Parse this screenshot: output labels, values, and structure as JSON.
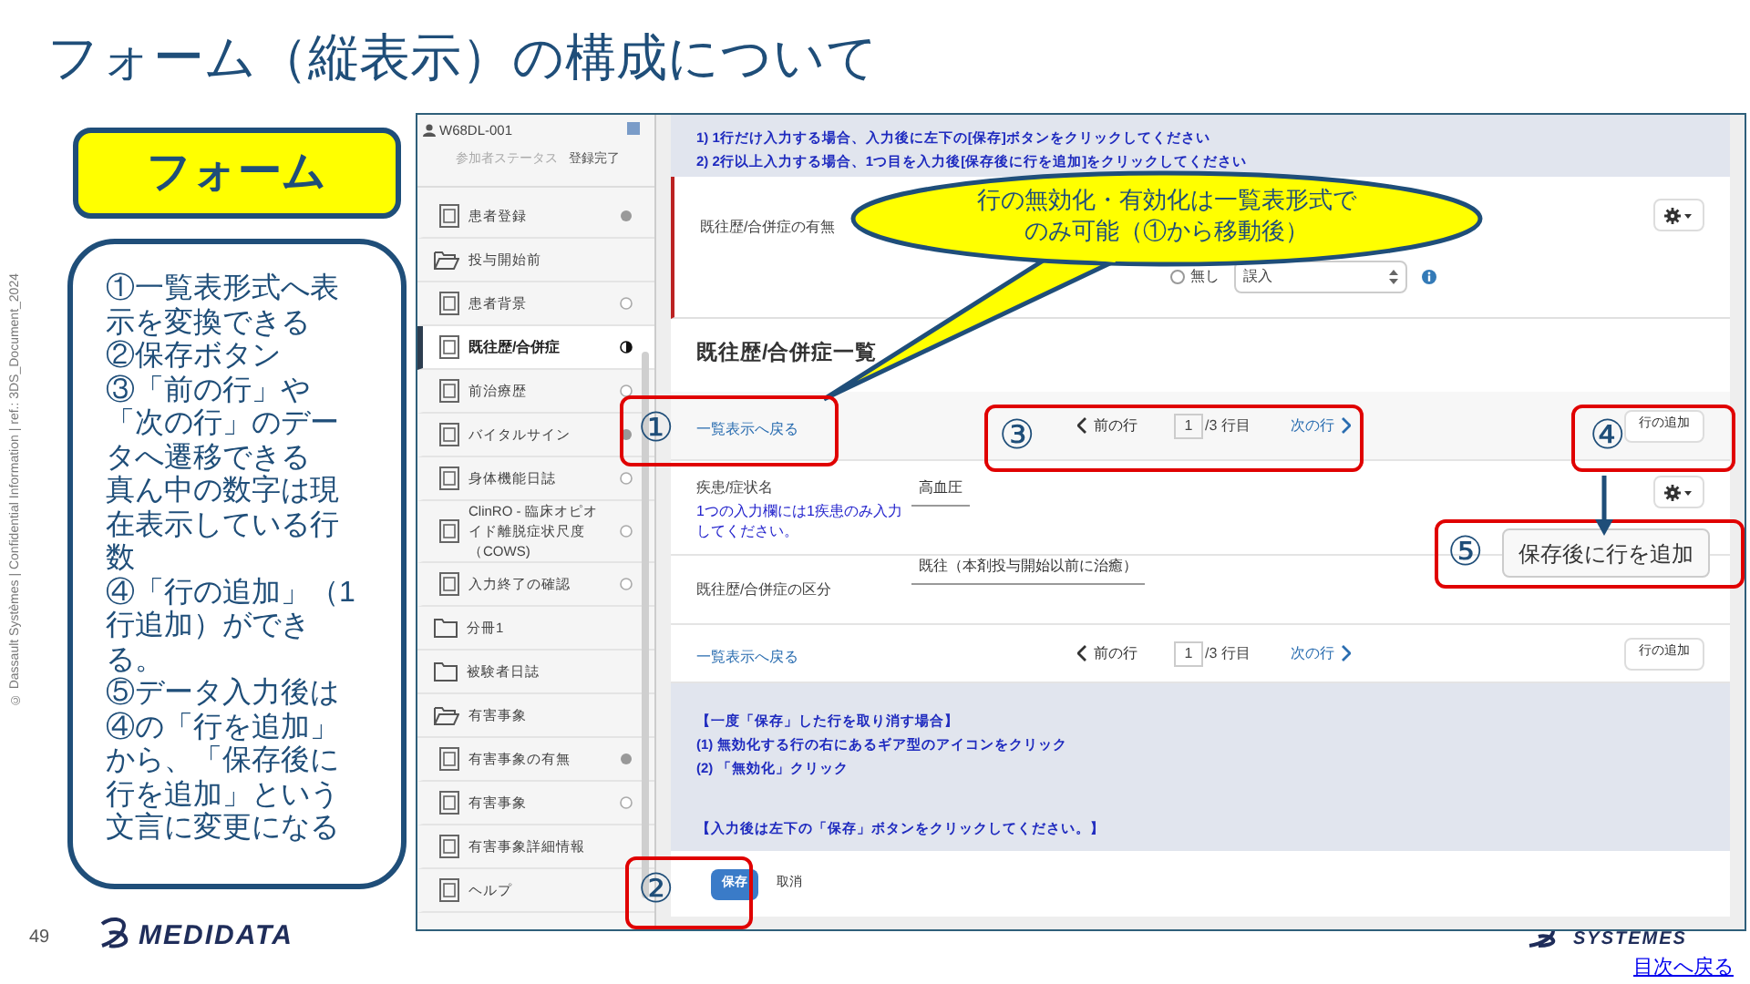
{
  "title": "フォーム（縦表示）の構成について",
  "form_label": "フォーム",
  "explanation": [
    "①一覧表形式へ表示を変換できる",
    "②保存ボタン",
    "③「前の行」や「次の行」のデータへ遷移できる",
    "真ん中の数字は現在表示している行数",
    "④「行の追加」（1行追加）ができる。",
    "⑤データ入力後は④の「行を追加」から、「保存後に行を追加」という文言に変更になる"
  ],
  "copyright": "© Dassault Systèmes | Confidential Information | ref.: 3DS_Document_2024",
  "page_number": "49",
  "footer_logo": "MEDIDATA",
  "corner_logo": "SYSTEMES",
  "toc_link": "目次へ戻る",
  "app": {
    "sidebar": {
      "subject": "W68DL-001",
      "status_label": "参加者ステータス",
      "status_value": "登録完了",
      "items": [
        {
          "kind": "page",
          "label": "患者登録",
          "complete": true,
          "partial": false,
          "selected": false
        },
        {
          "kind": "folder",
          "label": "投与開始前",
          "expanded": true
        },
        {
          "kind": "page",
          "label": "患者背景",
          "complete": false,
          "partial": false,
          "selected": false
        },
        {
          "kind": "page",
          "label": "既往歴/合併症",
          "complete": false,
          "partial": true,
          "selected": true
        },
        {
          "kind": "page",
          "label": "前治療歴",
          "complete": false,
          "partial": false,
          "selected": false
        },
        {
          "kind": "page",
          "label": "バイタルサイン",
          "complete": true,
          "partial": false,
          "selected": false
        },
        {
          "kind": "page",
          "label": "身体機能日誌",
          "complete": false,
          "partial": false,
          "selected": false
        },
        {
          "kind": "page",
          "label": "ClinRO - 臨床オピオイド離脱症状尺度（COWS)",
          "complete": false,
          "partial": false,
          "selected": false
        },
        {
          "kind": "page",
          "label": "入力終了の確認",
          "complete": false,
          "partial": false,
          "selected": false
        },
        {
          "kind": "folder",
          "label": "分冊1",
          "expanded": false
        },
        {
          "kind": "folder",
          "label": "被験者日誌",
          "expanded": false
        },
        {
          "kind": "folder",
          "label": "有害事象",
          "expanded": true
        },
        {
          "kind": "page",
          "label": "有害事象の有無",
          "complete": true,
          "partial": false,
          "selected": false
        },
        {
          "kind": "page",
          "label": "有害事象",
          "complete": false,
          "partial": false,
          "selected": false
        },
        {
          "kind": "page",
          "label": "有害事象詳細情報",
          "selected": false
        },
        {
          "kind": "page",
          "label": "ヘルプ",
          "selected": false
        }
      ]
    },
    "instructions": [
      "1) 1行だけ入力する場合、入力後に左下の[保存]ボタンをクリックしてください",
      "2) 2行以上入力する場合、1つ目を入力後[保存後に行を追加]をクリックしてください"
    ],
    "top_field": {
      "label": "既往歴/合併症の有無",
      "highlighted": true,
      "radio": {
        "label": "無し",
        "selected": false
      },
      "select_value": "誤入"
    },
    "section_heading": "既往歴/合併症一覧",
    "nav_bars": [
      {
        "back_link": "一覧表示へ戻る",
        "prev": "前の行",
        "current": "1",
        "of": "/3 行目",
        "next": "次の行",
        "add_button": "行の追加"
      },
      {
        "back_link": "一覧表示へ戻る",
        "prev": "前の行",
        "current": "1",
        "of": "/3 行目",
        "next": "次の行",
        "add_button": "行の追加"
      }
    ],
    "rows": [
      {
        "label": "疾患/症状名",
        "note": "1つの入力欄には1疾患のみ入力してください。",
        "value": "高血圧",
        "menu": true
      },
      {
        "label": "既往歴/合併症の区分",
        "value": "既往（本剤投与開始以前に治癒）",
        "menu": false
      }
    ],
    "notes": [
      {
        "lines": [
          "【一度「保存」した行を取り消す場合】",
          "(1) 無効化する行の右にあるギア型のアイコンをクリック",
          "(2) 「無効化」クリック"
        ]
      },
      {
        "lines": [
          "【入力後は左下の「保存」ボタンをクリックしてください。】"
        ]
      }
    ],
    "save_button": "保存",
    "cancel_link": "取消"
  },
  "callout": "行の無効化・有効化は一覧表形式でのみ可能（①から移動後）",
  "markers": [
    {
      "number": "①"
    },
    {
      "number": "②"
    },
    {
      "number": "③"
    },
    {
      "number": "④"
    },
    {
      "number": "⑤",
      "button": "保存後に行を追加"
    }
  ]
}
